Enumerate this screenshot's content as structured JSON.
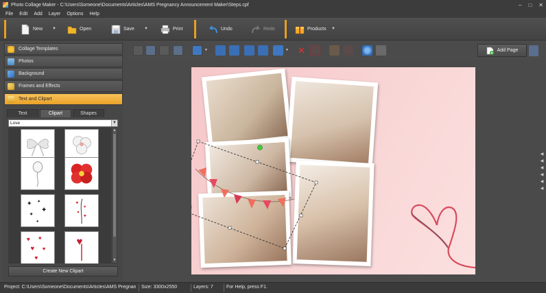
{
  "window": {
    "title": "Photo Collage Maker - C:\\Users\\Someone\\Documents\\Articles\\AMS Pregnancy Announcement Maker\\Steps.cpf",
    "controls": [
      "–",
      "□",
      "✕"
    ]
  },
  "menu": [
    "File",
    "Edit",
    "Add",
    "Layer",
    "Options",
    "Help"
  ],
  "toolbar": {
    "new_label": "New",
    "open_label": "Open",
    "save_label": "Save",
    "print_label": "Print",
    "undo_label": "Undo",
    "redo_label": "Redo",
    "products_label": "Products",
    "accent": "#e8a020"
  },
  "sidebar": {
    "categories": [
      {
        "label": "Collage Templates",
        "icon": "star-icon"
      },
      {
        "label": "Photos",
        "icon": "photo-icon"
      },
      {
        "label": "Background",
        "icon": "background-icon"
      },
      {
        "label": "Frames and Effects",
        "icon": "palette-icon"
      },
      {
        "label": "Text and Clipart",
        "icon": "trophy-icon",
        "active": true
      }
    ],
    "subtabs": [
      {
        "label": "Text"
      },
      {
        "label": "Clipart",
        "active": true
      },
      {
        "label": "Shapes"
      }
    ],
    "clipart_category": "Love",
    "create_button": "Create New Clipart"
  },
  "edit_toolbar": {
    "add_page_label": "Add Page"
  },
  "status": {
    "project": "Project: C:\\Users\\Someone\\Documents\\Articles\\AMS Pregnancy ...",
    "size": "Size: 3300x2550",
    "layers": "Layers: 7",
    "help": "For Help, press F1."
  },
  "colors": {
    "active_category": "#f0b23e",
    "page_background": "#f8d3d3",
    "heart": "#d84a5c"
  }
}
